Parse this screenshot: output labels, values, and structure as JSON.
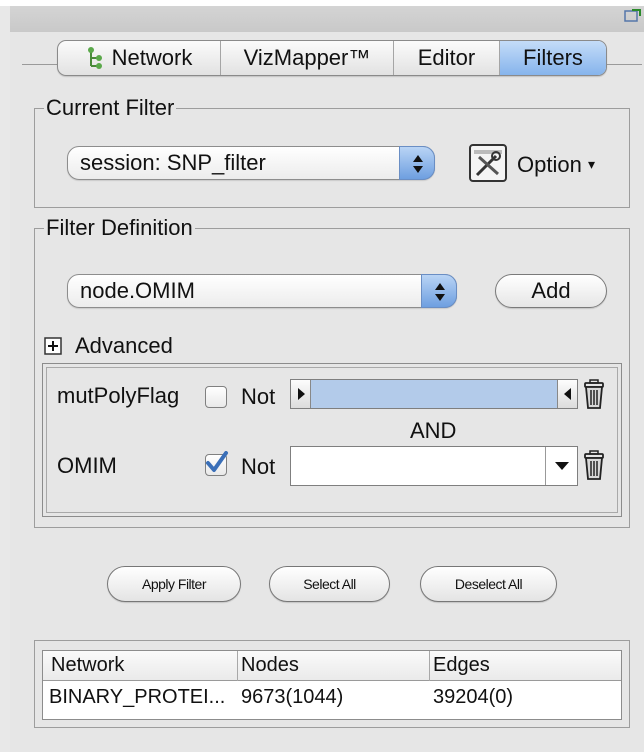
{
  "tabs": [
    {
      "label": "Network"
    },
    {
      "label": "VizMapper™"
    },
    {
      "label": "Editor"
    },
    {
      "label": "Filters",
      "selected": true
    }
  ],
  "current_filter": {
    "legend": "Current Filter",
    "selected": "session: SNP_filter",
    "option_label": "Option"
  },
  "filter_definition": {
    "legend": "Filter Definition",
    "attribute": "node.OMIM",
    "add_label": "Add",
    "advanced_label": "Advanced",
    "rows": [
      {
        "name": "mutPolyFlag",
        "not_label": "Not",
        "not_checked": false,
        "widget": "range-slider"
      },
      {
        "name": "OMIM",
        "not_label": "Not",
        "not_checked": true,
        "widget": "combo"
      }
    ],
    "joiner": "AND"
  },
  "buttons": {
    "apply": "Apply Filter",
    "select_all": "Select All",
    "deselect_all": "Deselect All"
  },
  "table": {
    "headers": [
      "Network",
      "Nodes",
      "Edges"
    ],
    "rows": [
      [
        "BINARY_PROTEI...",
        "9673(1044)",
        "39204(0)"
      ]
    ]
  },
  "colors": {
    "selected_tab": "#86b4ec",
    "slider_fill": "#b3cbea",
    "stepper": "#6e9fe0"
  }
}
